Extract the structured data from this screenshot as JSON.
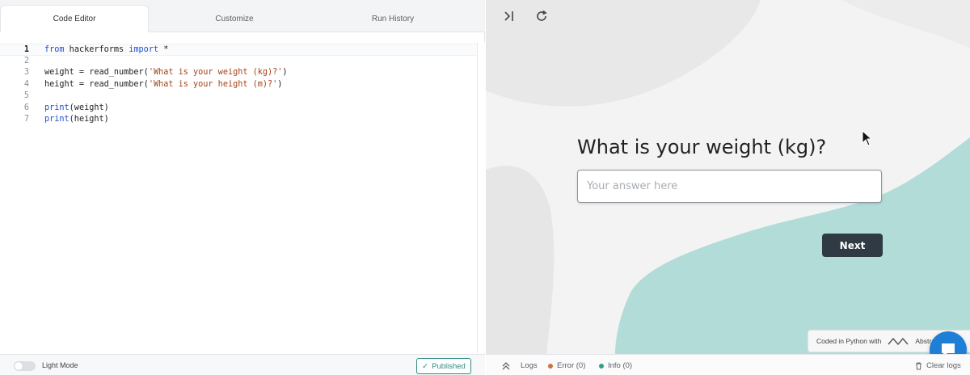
{
  "tabs": [
    {
      "label": "Code Editor",
      "active": true
    },
    {
      "label": "Customize",
      "active": false
    },
    {
      "label": "Run History",
      "active": false
    }
  ],
  "editor": {
    "current_line": 1,
    "lines": [
      {
        "n": "1",
        "tokens": [
          {
            "t": "from",
            "c": "kw"
          },
          {
            "t": " hackerforms "
          },
          {
            "t": "import",
            "c": "kw"
          },
          {
            "t": " *"
          }
        ]
      },
      {
        "n": "2",
        "tokens": []
      },
      {
        "n": "3",
        "tokens": [
          {
            "t": "weight = read_number("
          },
          {
            "t": "'What is your weight (kg)?'",
            "c": "str"
          },
          {
            "t": ")"
          }
        ]
      },
      {
        "n": "4",
        "tokens": [
          {
            "t": "height = read_number("
          },
          {
            "t": "'What is your height (m)?'",
            "c": "str"
          },
          {
            "t": ")"
          }
        ]
      },
      {
        "n": "5",
        "tokens": []
      },
      {
        "n": "6",
        "tokens": [
          {
            "t": "print",
            "c": "kw"
          },
          {
            "t": "(weight)"
          }
        ]
      },
      {
        "n": "7",
        "tokens": [
          {
            "t": "print",
            "c": "kw"
          },
          {
            "t": "(height)"
          }
        ]
      }
    ]
  },
  "footer_left": {
    "light_mode_label": "Light Mode",
    "published_label": "Published",
    "published_check": "✓"
  },
  "preview": {
    "question": "What is your weight (kg)?",
    "answer_value": "",
    "answer_placeholder": "Your answer here",
    "next_label": "Next",
    "coded_in": "Coded in Python with",
    "brand": "Abstra",
    "controls": [
      "collapse-panel-icon",
      "refresh-icon"
    ]
  },
  "footer_right": {
    "logs_label": "Logs",
    "error_label": "Error (0)",
    "info_label": "Info (0)",
    "clear_label": "Clear logs"
  },
  "colors": {
    "teal_blob": "#b2dcd8",
    "error_dot": "#c9733f",
    "info_dot": "#2f9e8f",
    "chat_button": "#1f7fd6",
    "next_button": "#303a44"
  }
}
